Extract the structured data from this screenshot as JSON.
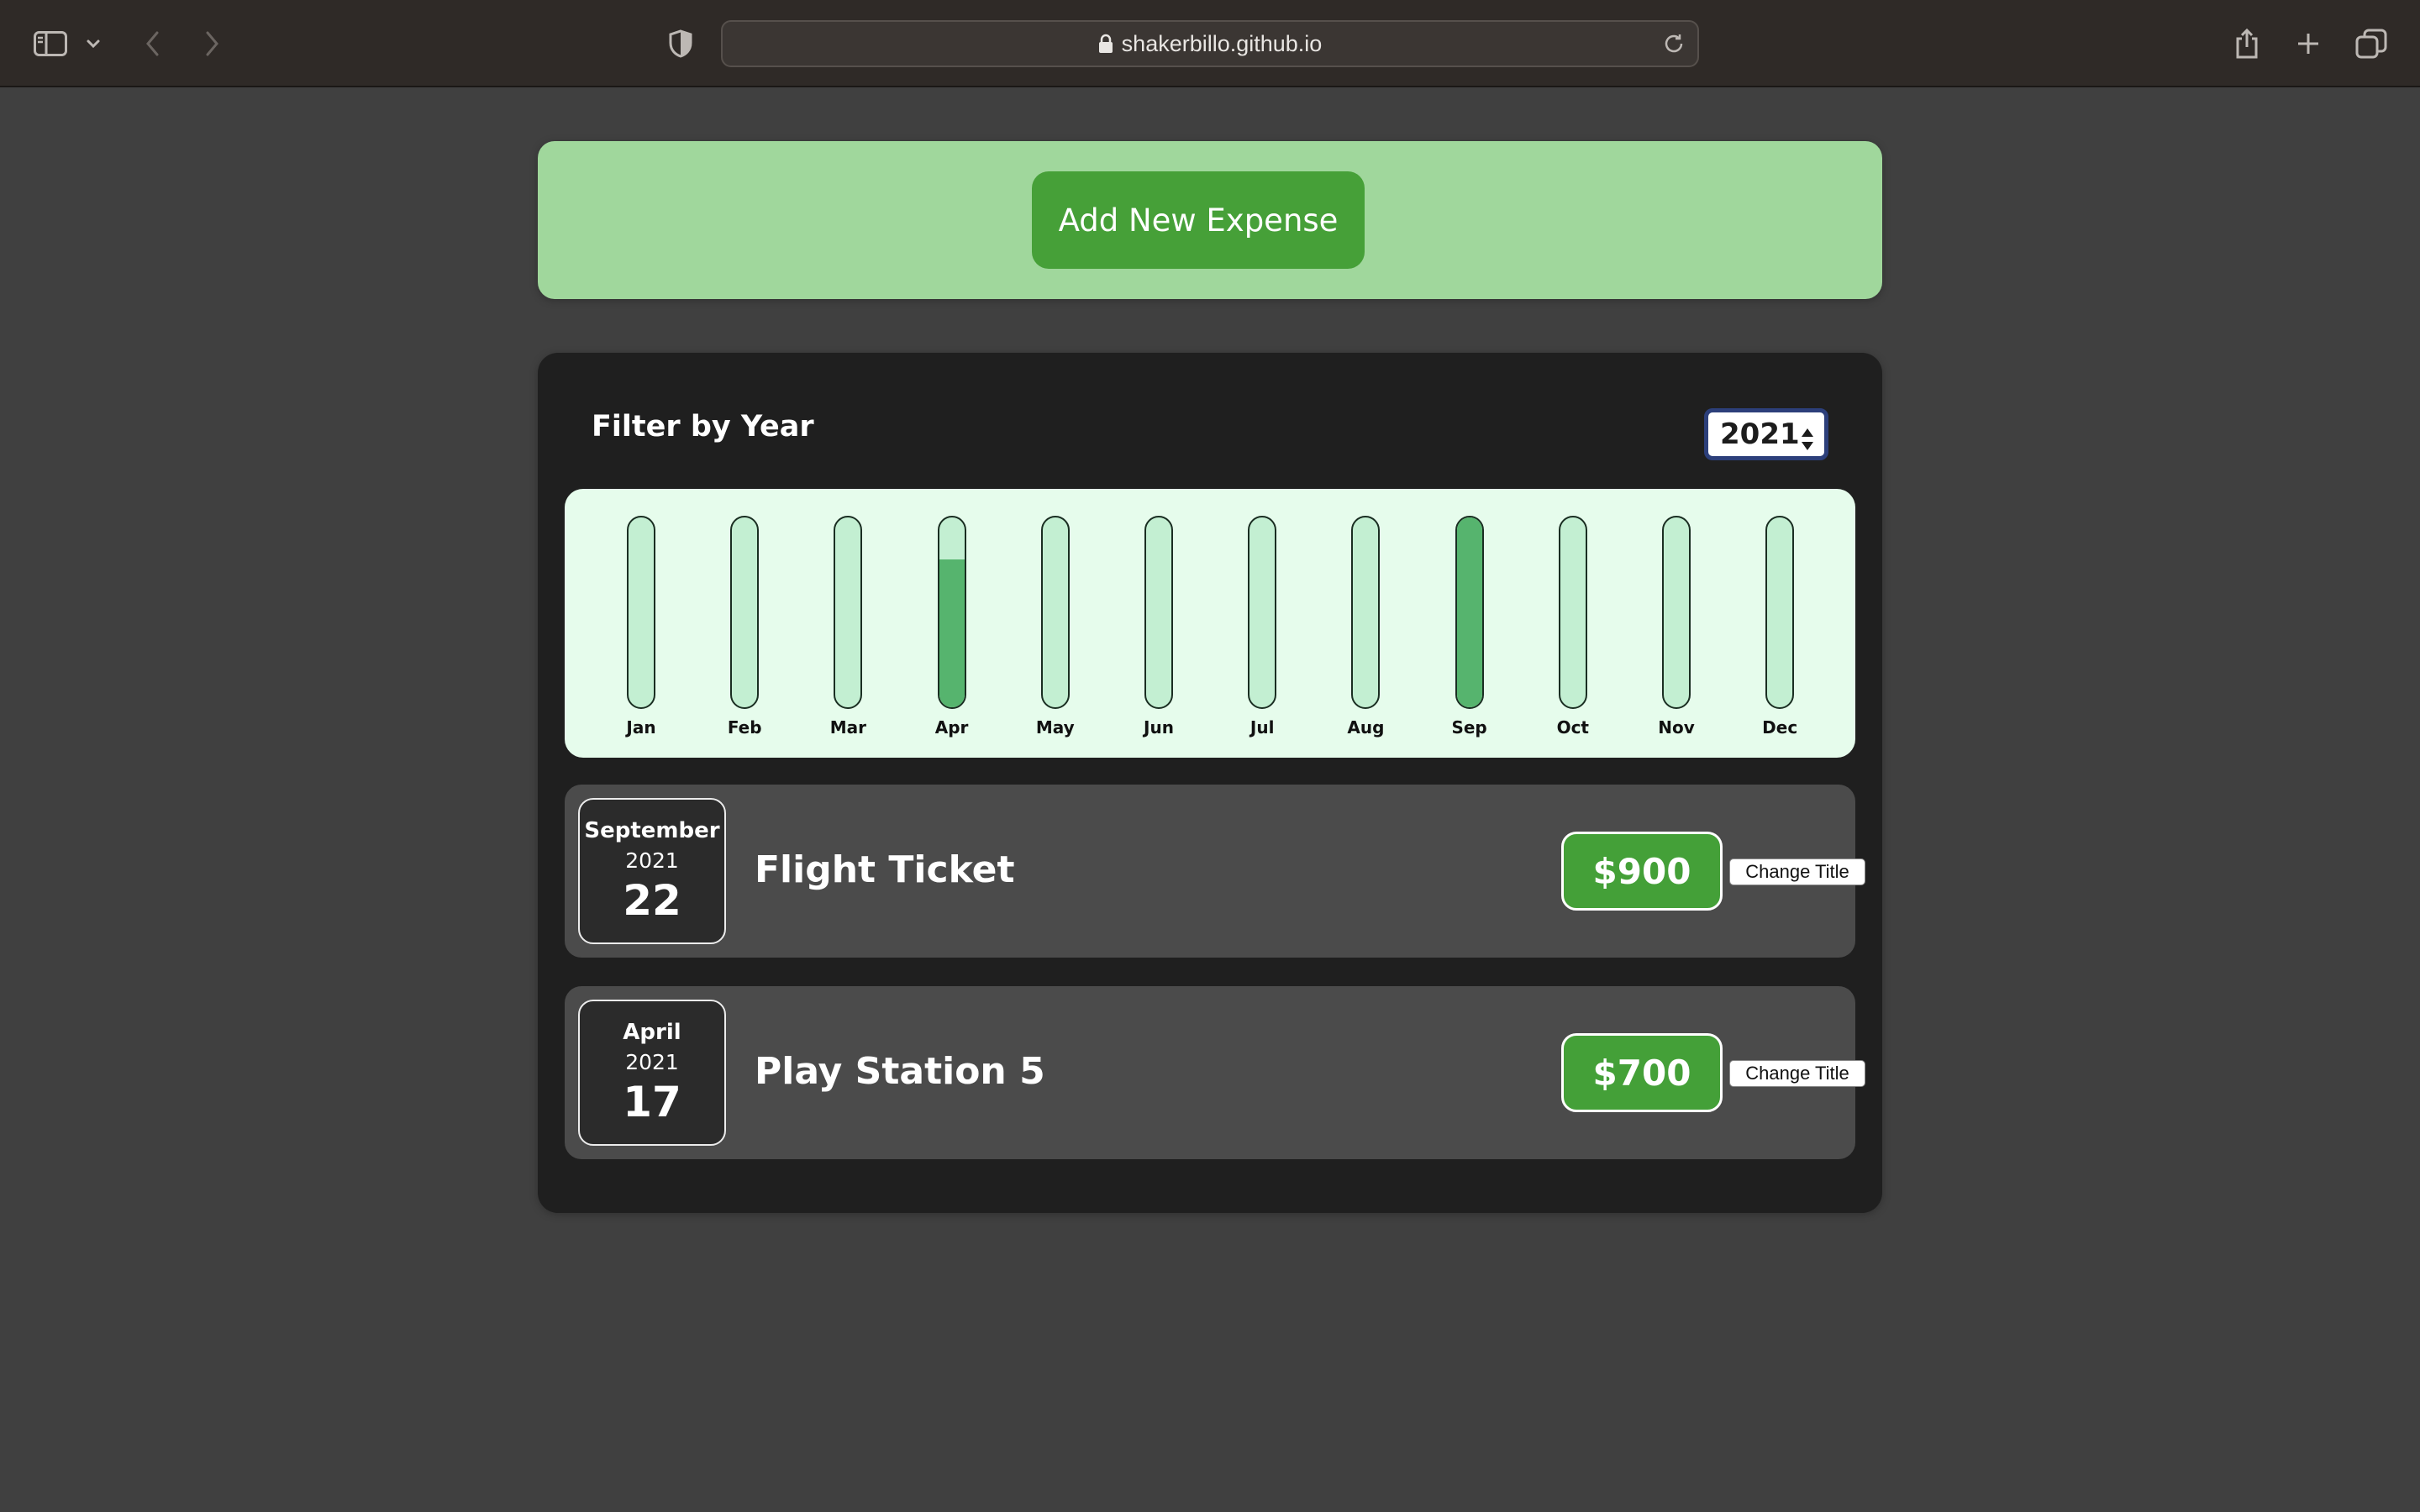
{
  "browser": {
    "url": "shakerbillo.github.io",
    "icons": [
      "sidebar-icon",
      "chevron-down-icon",
      "back-icon",
      "forward-icon",
      "privacy-shield-icon",
      "lock-icon",
      "reload-icon",
      "share-icon",
      "new-tab-icon",
      "tabs-overview-icon"
    ]
  },
  "new_expense": {
    "add_label": "Add New Expense"
  },
  "filter": {
    "label": "Filter by Year",
    "selected_year": "2021"
  },
  "chart_data": {
    "type": "bar",
    "categories": [
      "Jan",
      "Feb",
      "Mar",
      "Apr",
      "May",
      "Jun",
      "Jul",
      "Aug",
      "Sep",
      "Oct",
      "Nov",
      "Dec"
    ],
    "values": [
      0,
      0,
      0,
      700,
      0,
      0,
      0,
      0,
      900,
      0,
      0,
      0
    ],
    "ylim": [
      0,
      900
    ]
  },
  "expenses": [
    {
      "month": "September",
      "year": "2021",
      "day": "22",
      "title": "Flight Ticket",
      "amount": "$900",
      "action_label": "Change Title"
    },
    {
      "month": "April",
      "year": "2021",
      "day": "17",
      "title": "Play Station 5",
      "amount": "$700",
      "action_label": "Change Title"
    }
  ],
  "colors": {
    "accent_green": "#46a038",
    "chart_fill": "#56b46e",
    "chart_track": "#c3efd2",
    "chart_bg": "#e6fcec",
    "new_expense_bg": "#a0d79c"
  }
}
